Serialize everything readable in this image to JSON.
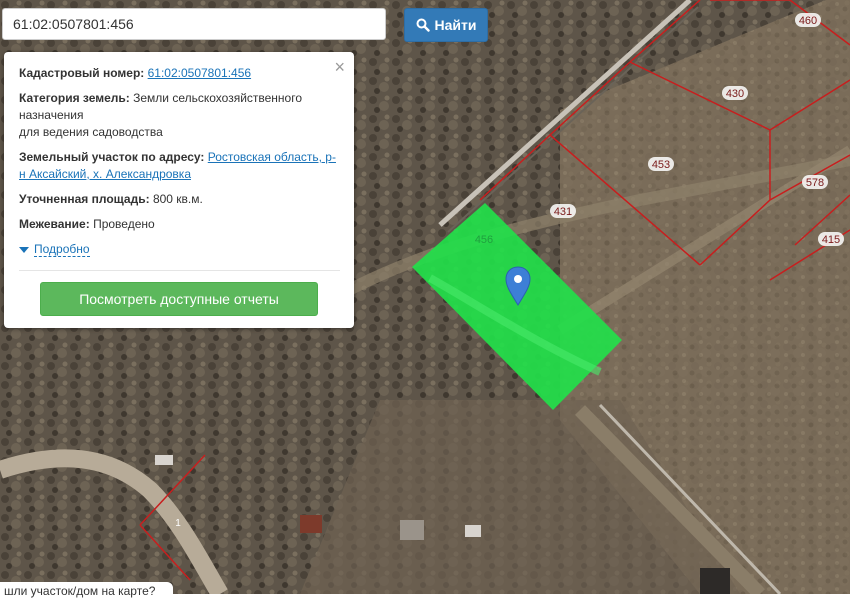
{
  "search": {
    "value": "61:02:0507801:456",
    "button_label": "Найти"
  },
  "popup": {
    "cadastral_label": "Кадастровый номер:",
    "cadastral_value": "61:02:0507801:456",
    "category_label": "Категория земель:",
    "category_line1": "Земли сельскохозяйственного",
    "category_line2": "назначения",
    "category_line3": "для ведения садоводства",
    "address_label": "Земельный участок по адресу:",
    "address_value": "Ростовская область, р-н Аксайский, х. Александровка",
    "area_label": "Уточненная площадь:",
    "area_value": "800 кв.м.",
    "survey_label": "Межевание:",
    "survey_value": "Проведено",
    "more_label": "Подробно",
    "reports_button": "Посмотреть доступные отчеты",
    "close_symbol": "×"
  },
  "map": {
    "parcel_labels": [
      "460",
      "430",
      "453",
      "578",
      "431",
      "415",
      "456",
      "1"
    ],
    "selected_parcel_color": "#22e04a",
    "boundary_color": "#c81e1e",
    "marker_color": "#3d7fd6"
  },
  "bottom_tip": "шли участок/дом на карте?"
}
